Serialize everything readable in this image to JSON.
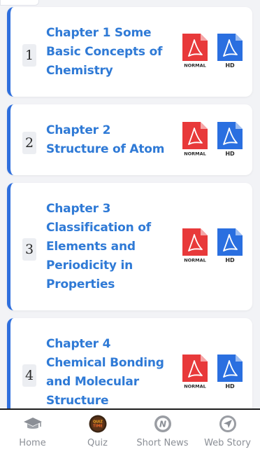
{
  "chapters": [
    {
      "num": "1",
      "title": "Chapter 1 Some Basic Concepts of Chemistry",
      "normal_label": "NORMAL",
      "hd_label": "HD"
    },
    {
      "num": "2",
      "title": "Chapter 2 Structure of Atom",
      "normal_label": "NORMAL",
      "hd_label": "HD"
    },
    {
      "num": "3",
      "title": "Chapter 3 Classification of Elements and Periodicity in Properties",
      "normal_label": "NORMAL",
      "hd_label": "HD"
    },
    {
      "num": "4",
      "title": "Chapter 4 Chemical Bonding and Molecular Structure",
      "normal_label": "NORMAL",
      "hd_label": "HD"
    }
  ],
  "nav": {
    "home": "Home",
    "quiz": "Quiz",
    "quiz_logo_text": "QUIZ TIME",
    "short_news": "Short News",
    "web_story": "Web Story"
  },
  "colors": {
    "accent": "#2f6fdd",
    "title": "#2f7ad6",
    "pdf_red": "#e8393a",
    "pdf_blue": "#2a6fe0"
  },
  "icons": {
    "normal_pdf": "pdf-normal-icon",
    "hd_pdf": "pdf-hd-icon",
    "home": "graduation-cap-icon",
    "quiz": "quiz-time-icon",
    "short_news": "news-n-icon",
    "web_story": "paper-plane-icon"
  }
}
